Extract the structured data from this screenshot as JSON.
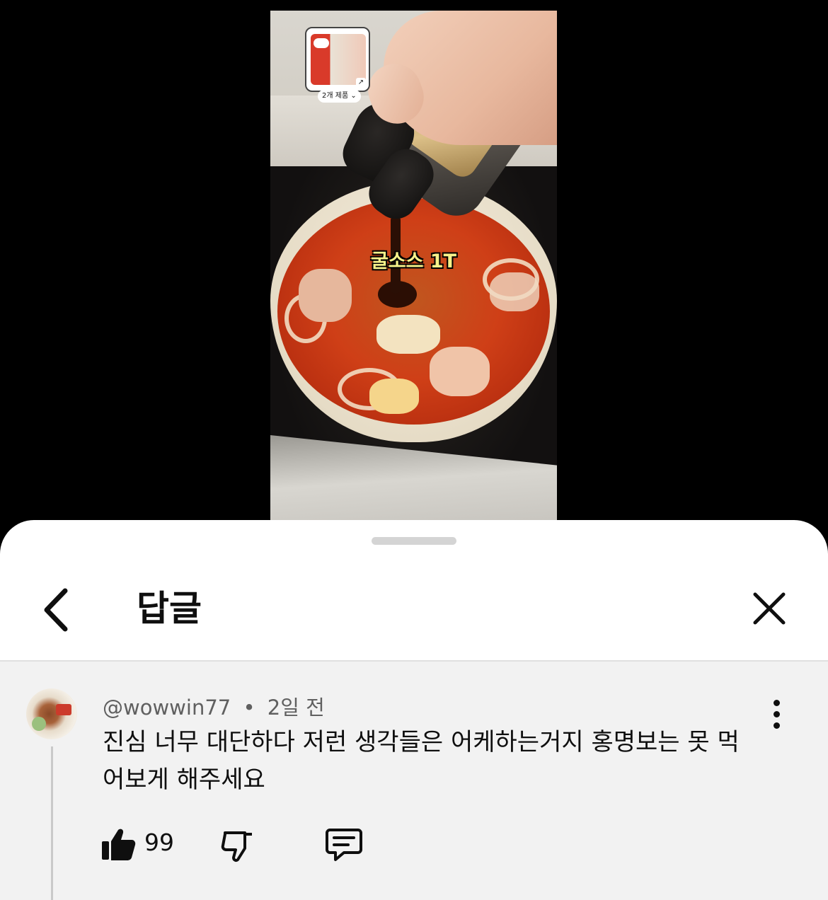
{
  "video": {
    "overlay_caption": "굴소스 1T",
    "product_count_label": "2개 제품",
    "product_expand_icon": "chevron-down-icon",
    "product_link_icon": "external-link-icon"
  },
  "sheet": {
    "title": "답글",
    "back_icon": "chevron-left-icon",
    "close_icon": "close-icon"
  },
  "comment": {
    "author": "@wowwin77",
    "separator": "•",
    "time": "2일 전",
    "text": "진심 너무 대단하다 저런 생각들은 어케하는거지 홍명보는 못 먹어보게 해주세요",
    "like_count": "99",
    "icons": {
      "like": "thumbs-up-filled-icon",
      "dislike": "thumbs-down-icon",
      "reply": "reply-comment-icon",
      "more": "more-vertical-icon"
    }
  },
  "colors": {
    "sheet_bg": "#ffffff",
    "comment_bg": "#f2f2f2",
    "text_primary": "#0f0f0f",
    "text_secondary": "#606060",
    "caption_yellow": "#f7f28a"
  }
}
